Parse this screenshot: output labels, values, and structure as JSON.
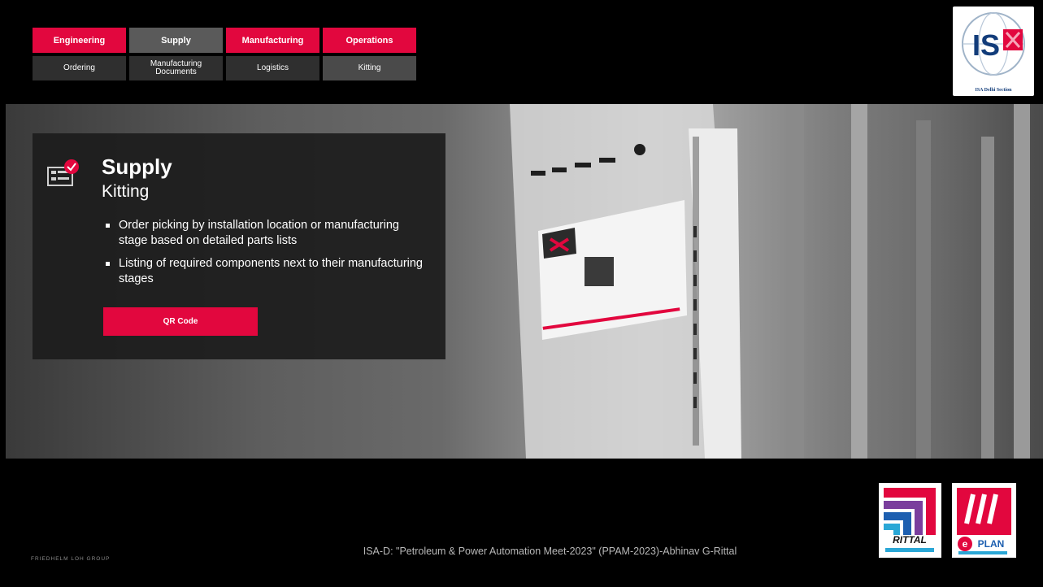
{
  "nav": {
    "top": [
      {
        "label": "Engineering"
      },
      {
        "label": "Supply"
      },
      {
        "label": "Manufacturing"
      },
      {
        "label": "Operations"
      }
    ],
    "bottom": [
      {
        "label": "Ordering"
      },
      {
        "label": "Manufacturing Documents"
      },
      {
        "label": "Logistics"
      },
      {
        "label": "Kitting"
      }
    ]
  },
  "isa_logo": {
    "text": "IS",
    "caption": "ISA Delhi Section"
  },
  "panel": {
    "title": "Supply",
    "subtitle": "Kitting",
    "bullets": [
      "Order picking by installation location or manufacturing stage based on detailed parts lists",
      "Listing of required components next to their manufacturing stages"
    ],
    "button_label": "QR Code"
  },
  "footer": {
    "left": "FRIEDHELM LOH GROUP",
    "center": "ISA-D: \"Petroleum & Power Automation Meet-2023\" (PPAM-2023)-Abhinav G-Rittal"
  },
  "partner_logos": {
    "rittal": "RITTAL",
    "eplan": "PLAN"
  },
  "colors": {
    "accent": "#e2073e",
    "background": "#000000"
  }
}
